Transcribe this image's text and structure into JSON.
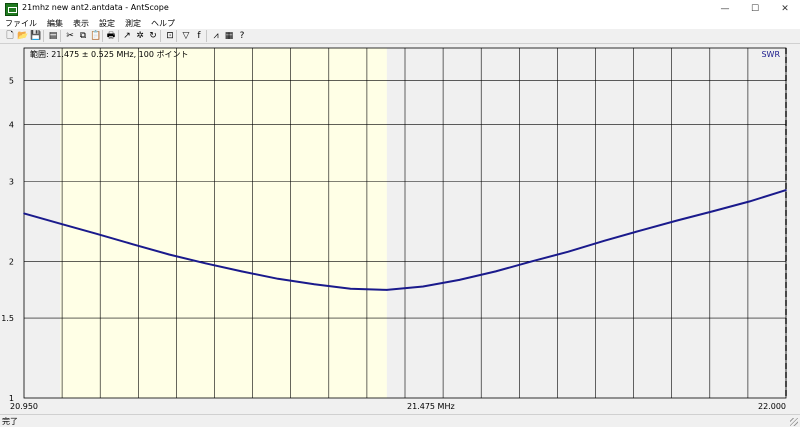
{
  "window": {
    "title": "21mhz new ant2.antdata - AntScope",
    "minimize_glyph": "—",
    "maximize_glyph": "☐",
    "close_glyph": "✕"
  },
  "menu": {
    "items": [
      "ファイル",
      "編集",
      "表示",
      "設定",
      "測定",
      "ヘルプ"
    ]
  },
  "toolbar": {
    "buttons": [
      {
        "name": "new-file-icon",
        "glyph": "🗋"
      },
      {
        "name": "open-folder-icon",
        "glyph": "📂"
      },
      {
        "name": "save-icon",
        "glyph": "💾"
      },
      {
        "name": "format-icon",
        "glyph": "▤"
      },
      {
        "name": "cut-icon",
        "glyph": "✂"
      },
      {
        "name": "copy-icon",
        "glyph": "⧉"
      },
      {
        "name": "paste-icon",
        "glyph": "📋"
      },
      {
        "name": "print-icon",
        "glyph": "🖶"
      },
      {
        "name": "chart-icon",
        "glyph": "↗"
      },
      {
        "name": "scan-icon",
        "glyph": "✲"
      },
      {
        "name": "refresh-icon",
        "glyph": "↻"
      },
      {
        "name": "zoom-icon",
        "glyph": "⊡"
      },
      {
        "name": "filter-icon",
        "glyph": "▽"
      },
      {
        "name": "frequency-icon",
        "glyph": "f"
      },
      {
        "name": "swr-graph-icon",
        "glyph": "⩘"
      },
      {
        "name": "calendar-icon",
        "glyph": "▦"
      },
      {
        "name": "help-icon",
        "glyph": "?"
      }
    ]
  },
  "plot": {
    "info_text": "範囲: 21.475 ± 0.525 MHz, 100 ポイント",
    "mode_label": "SWR",
    "colors": {
      "background": "#f0f0f0",
      "highlight_band": "#ffffe6",
      "grid": "#000000",
      "trace": "#1a1a8c"
    }
  },
  "status": {
    "text": "完了"
  },
  "chart_data": {
    "type": "line",
    "x_range": [
      20.95,
      22.0
    ],
    "ylim": [
      1,
      5.9
    ],
    "y_scale": "log",
    "y_ticks": [
      1,
      1.5,
      2,
      3,
      4,
      5
    ],
    "y_tick_labels": [
      "1",
      "1.5",
      "2",
      "3",
      "4",
      "5"
    ],
    "x_tick_labels": [
      {
        "value": 20.95,
        "label": "20.950"
      },
      {
        "value": 21.475,
        "label": "21.475 MHz"
      },
      {
        "value": 22.0,
        "label": "22.000"
      }
    ],
    "x_grid_count": 20,
    "highlight_band": [
      21.0,
      21.45
    ],
    "grid": true,
    "series": [
      {
        "x": [
          20.95,
          21.0,
          21.05,
          21.1,
          21.15,
          21.2,
          21.25,
          21.3,
          21.35,
          21.4,
          21.45,
          21.5,
          21.55,
          21.6,
          21.65,
          21.7,
          21.75,
          21.8,
          21.85,
          21.9,
          21.95,
          22.0
        ],
        "y": [
          2.55,
          2.42,
          2.3,
          2.18,
          2.07,
          1.98,
          1.9,
          1.83,
          1.78,
          1.74,
          1.73,
          1.76,
          1.82,
          1.9,
          2.0,
          2.1,
          2.22,
          2.34,
          2.46,
          2.58,
          2.71,
          2.87
        ]
      }
    ]
  }
}
